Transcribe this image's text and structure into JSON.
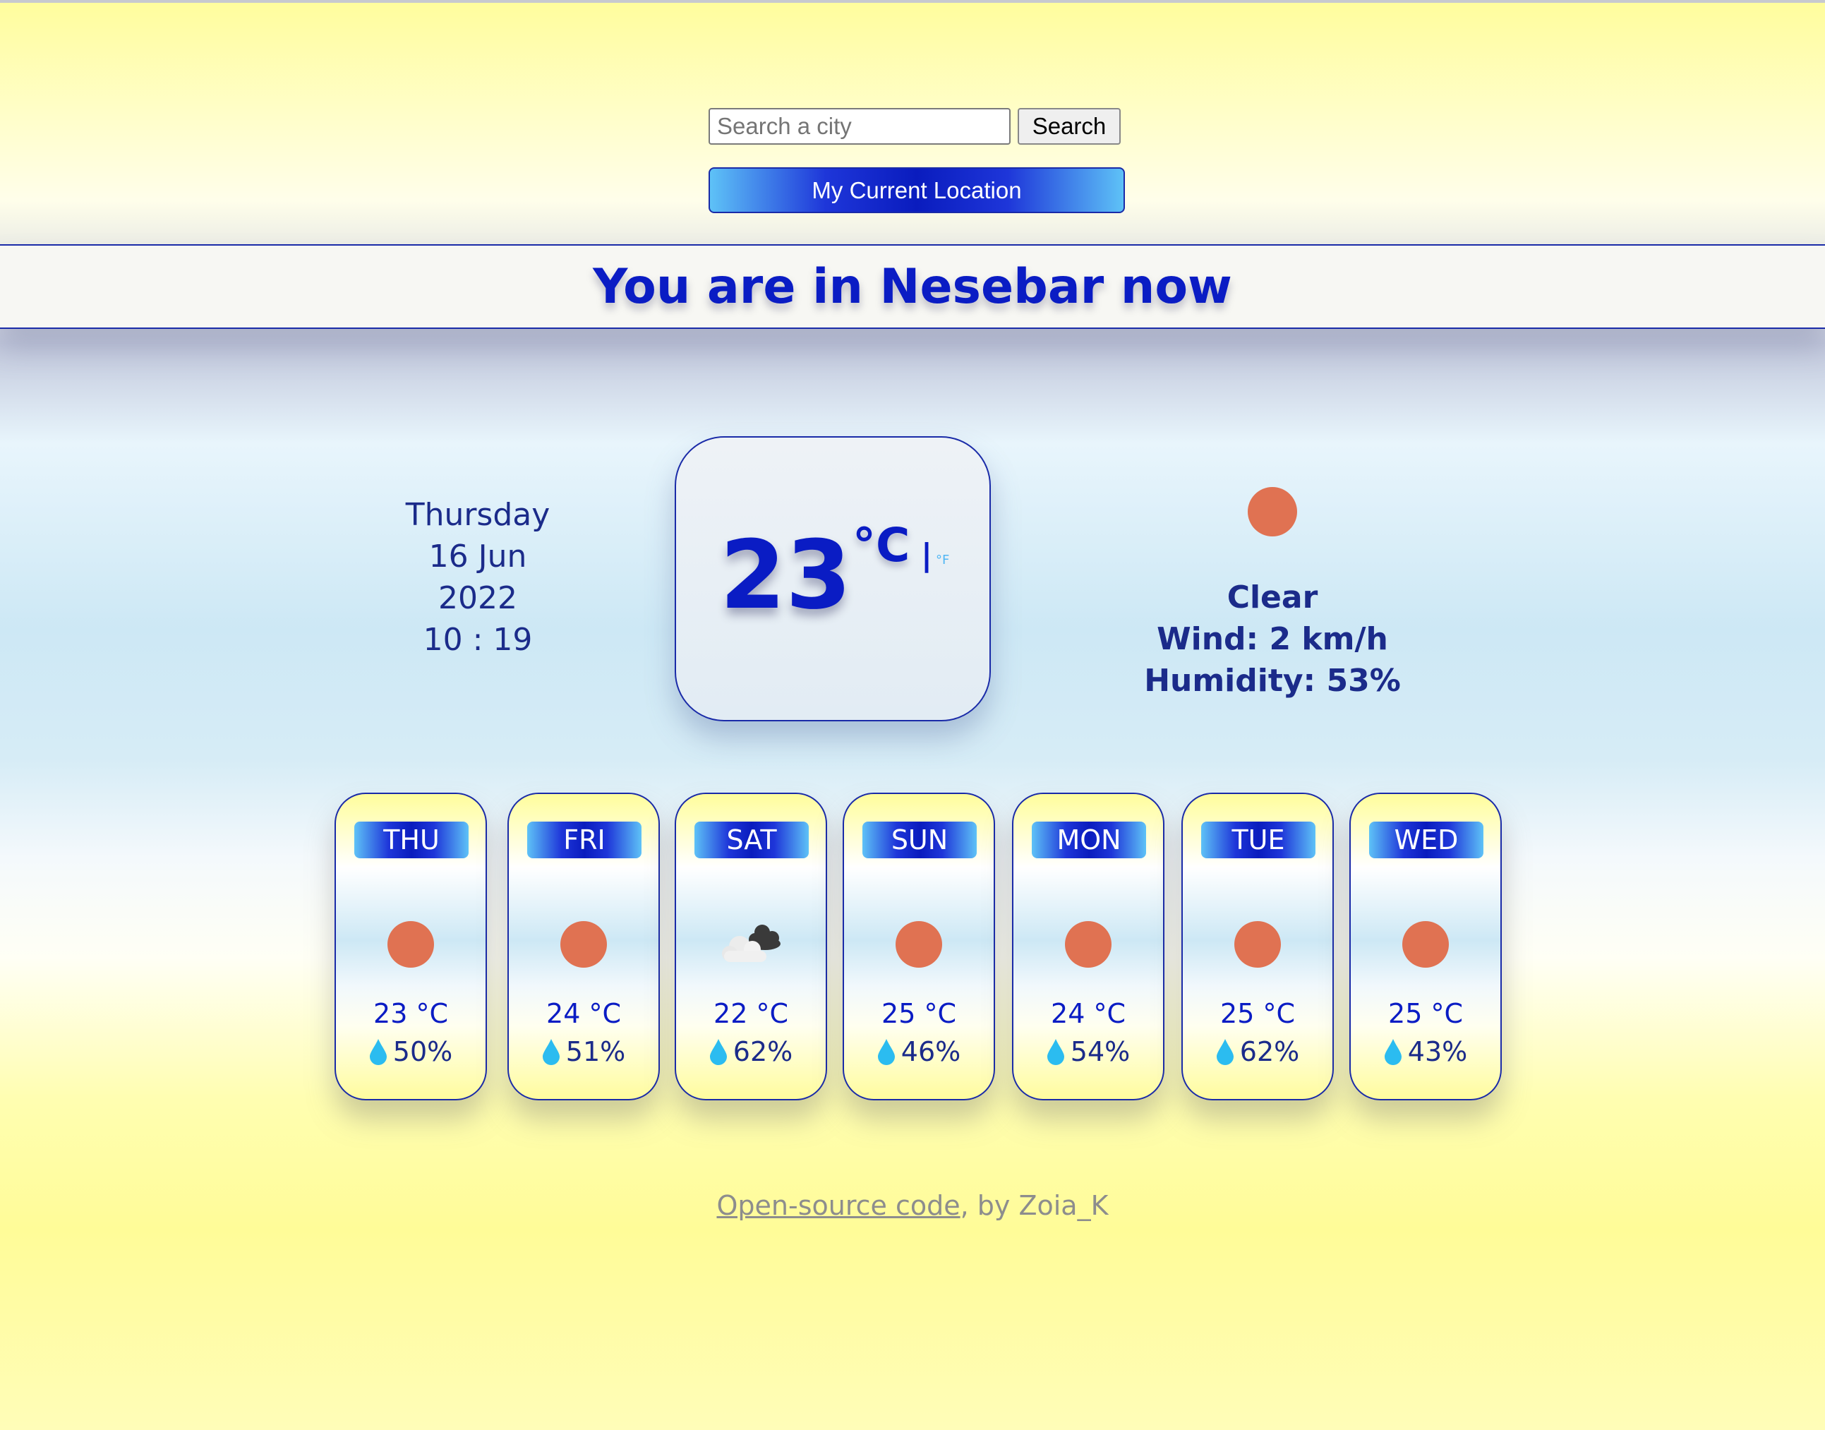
{
  "search": {
    "placeholder": "Search a city",
    "button_label": "Search"
  },
  "location_button_label": "My Current Location",
  "city_title": "You are in Nesebar now",
  "current": {
    "day": "Thursday",
    "date": "16 Jun",
    "year": "2022",
    "time": "10 : 19",
    "temperature": "23",
    "unit_celsius": "°C",
    "unit_separator": "|",
    "unit_fahrenheit": "°F",
    "condition": "Clear",
    "wind": "Wind: 2 km/h",
    "humidity": "Humidity: 53%",
    "icon": "sun-icon"
  },
  "forecast": [
    {
      "day": "THU",
      "temp": "23 °C",
      "humidity": "50%",
      "icon": "sun-icon"
    },
    {
      "day": "FRI",
      "temp": "24 °C",
      "humidity": "51%",
      "icon": "sun-icon"
    },
    {
      "day": "SAT",
      "temp": "22 °C",
      "humidity": "62%",
      "icon": "cloud-icon"
    },
    {
      "day": "SUN",
      "temp": "25 °C",
      "humidity": "46%",
      "icon": "sun-icon"
    },
    {
      "day": "MON",
      "temp": "24 °C",
      "humidity": "54%",
      "icon": "sun-icon"
    },
    {
      "day": "TUE",
      "temp": "25 °C",
      "humidity": "62%",
      "icon": "sun-icon"
    },
    {
      "day": "WED",
      "temp": "25 °C",
      "humidity": "43%",
      "icon": "sun-icon"
    }
  ],
  "footer": {
    "link_text": "Open-source code",
    "suffix": ", by Zoia_K"
  },
  "colors": {
    "primary_blue": "#0a1cc4",
    "sun": "#e07252",
    "drop": "#2bbcf0",
    "background_yellow": "#fffd9c"
  }
}
